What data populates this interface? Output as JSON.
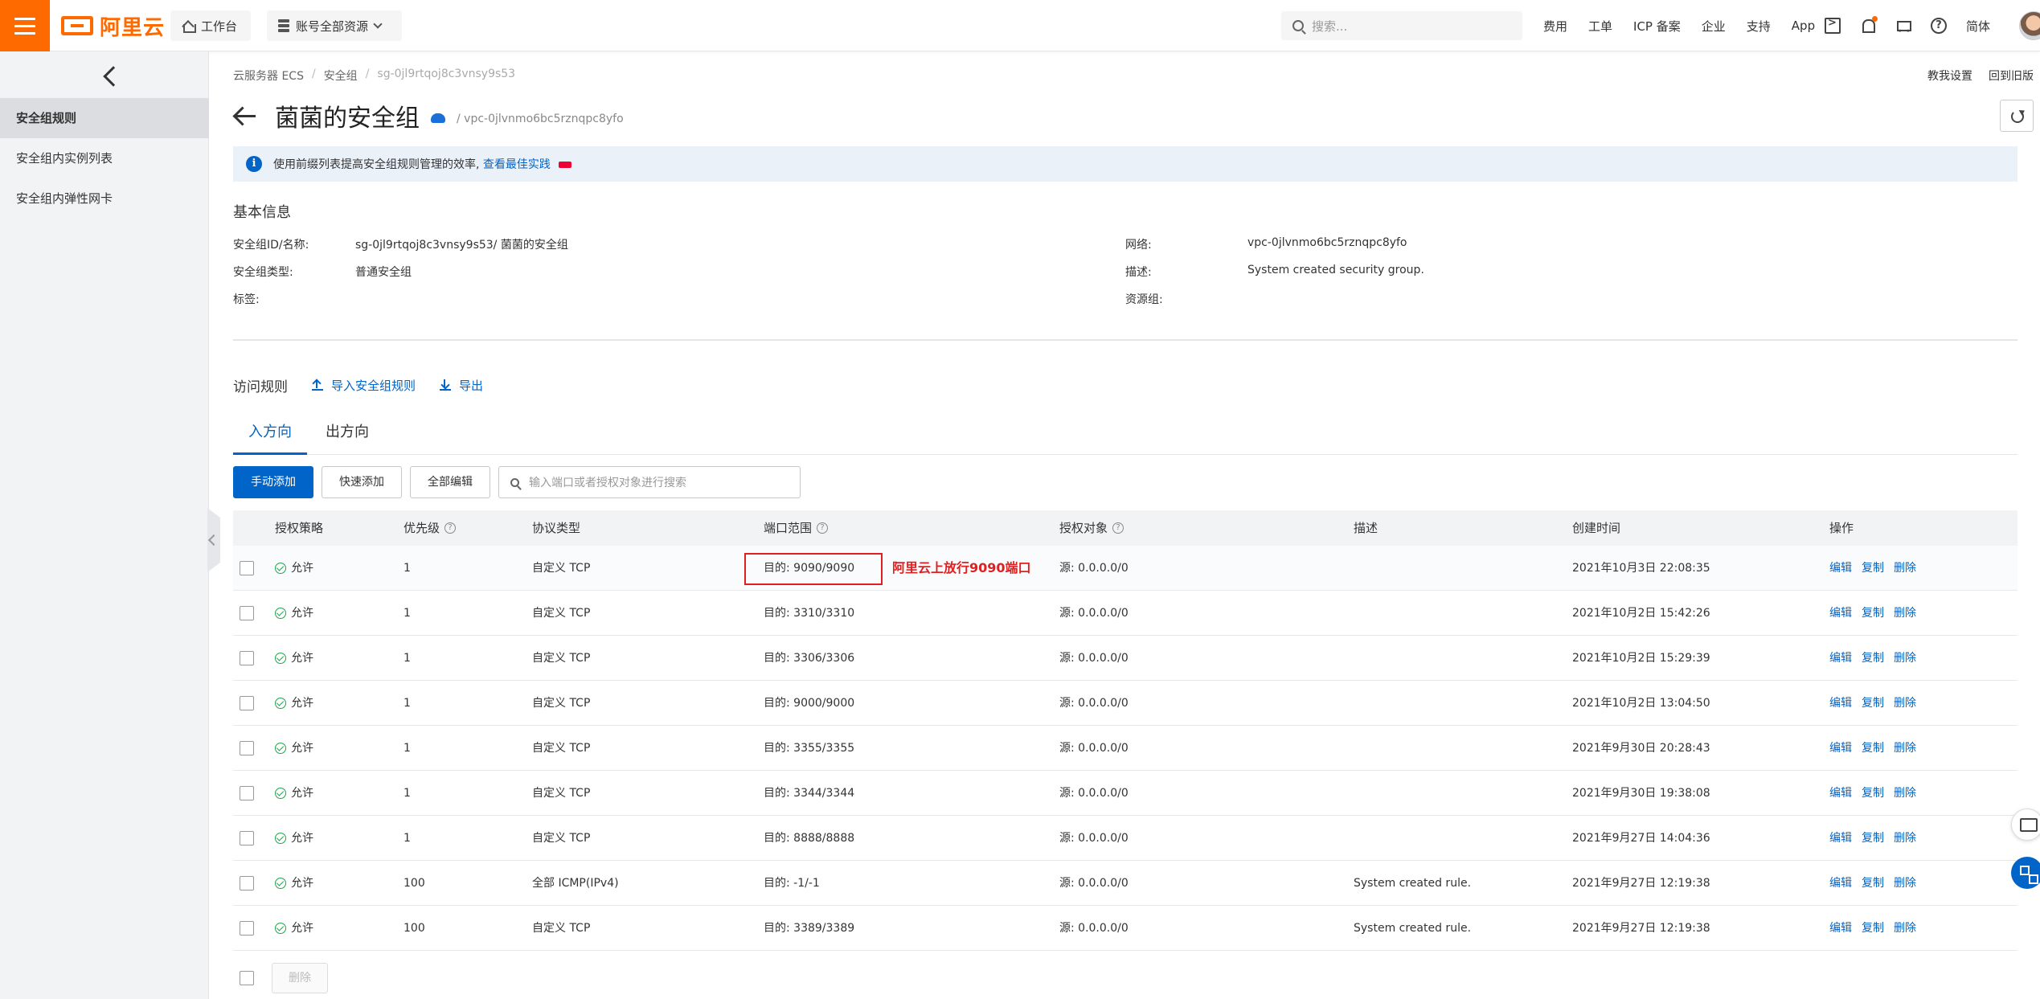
{
  "topbar": {
    "logo_text": "阿里云",
    "workbench": "工作台",
    "resources": "账号全部资源",
    "search_placeholder": "搜索...",
    "links": [
      "费用",
      "工单",
      "ICP 备案",
      "企业",
      "支持",
      "App"
    ],
    "lang": "简体",
    "brand_color": "#ff6a00"
  },
  "sidebar": {
    "items": [
      {
        "label": "安全组规则",
        "active": true
      },
      {
        "label": "安全组内实例列表",
        "active": false
      },
      {
        "label": "安全组内弹性网卡",
        "active": false
      }
    ]
  },
  "breadcrumb": {
    "items": [
      "云服务器 ECS",
      "安全组",
      "sg-0jl9rtqoj8c3vnsy9s53"
    ]
  },
  "header": {
    "title": "菌菌的安全组",
    "vpc": "/ vpc-0jlvnmo6bc5rznqpc8yfo",
    "links": [
      "教我设置",
      "回到旧版"
    ]
  },
  "notice": {
    "text": "使用前缀列表提高安全组规则管理的效率,",
    "link": "查看最佳实践"
  },
  "basic_info": {
    "title": "基本信息",
    "left": [
      {
        "k": "安全组ID/名称:",
        "v": "sg-0jl9rtqoj8c3vnsy9s53/ 菌菌的安全组"
      },
      {
        "k": "安全组类型:",
        "v": "普通安全组"
      },
      {
        "k": "标签:",
        "v": ""
      }
    ],
    "right": [
      {
        "k": "网络:",
        "v": "vpc-0jlvnmo6bc5rznqpc8yfo"
      },
      {
        "k": "描述:",
        "v": "System created security group."
      },
      {
        "k": "资源组:",
        "v": ""
      }
    ]
  },
  "rules": {
    "title": "访问规则",
    "import": "导入安全组规则",
    "export": "导出",
    "tabs": [
      "入方向",
      "出方向"
    ],
    "buttons": {
      "manual": "手动添加",
      "quick": "快速添加",
      "edit_all": "全部编辑"
    },
    "search_placeholder": "输入端口或者授权对象进行搜索",
    "columns": [
      "授权策略",
      "优先级",
      "协议类型",
      "端口范围",
      "授权对象",
      "描述",
      "创建时间",
      "操作"
    ],
    "annotation": "阿里云上放行9090端口",
    "ops": [
      "编辑",
      "复制",
      "删除"
    ],
    "delete_btn": "删除",
    "rows": [
      {
        "policy": "允许",
        "priority": "1",
        "protocol": "自定义 TCP",
        "port": "目的: 9090/9090",
        "auth": "源: 0.0.0.0/0",
        "desc": "",
        "time": "2021年10月3日 22:08:35"
      },
      {
        "policy": "允许",
        "priority": "1",
        "protocol": "自定义 TCP",
        "port": "目的: 3310/3310",
        "auth": "源: 0.0.0.0/0",
        "desc": "",
        "time": "2021年10月2日 15:42:26"
      },
      {
        "policy": "允许",
        "priority": "1",
        "protocol": "自定义 TCP",
        "port": "目的: 3306/3306",
        "auth": "源: 0.0.0.0/0",
        "desc": "",
        "time": "2021年10月2日 15:29:39"
      },
      {
        "policy": "允许",
        "priority": "1",
        "protocol": "自定义 TCP",
        "port": "目的: 9000/9000",
        "auth": "源: 0.0.0.0/0",
        "desc": "",
        "time": "2021年10月2日 13:04:50"
      },
      {
        "policy": "允许",
        "priority": "1",
        "protocol": "自定义 TCP",
        "port": "目的: 3355/3355",
        "auth": "源: 0.0.0.0/0",
        "desc": "",
        "time": "2021年9月30日 20:28:43"
      },
      {
        "policy": "允许",
        "priority": "1",
        "protocol": "自定义 TCP",
        "port": "目的: 3344/3344",
        "auth": "源: 0.0.0.0/0",
        "desc": "",
        "time": "2021年9月30日 19:38:08"
      },
      {
        "policy": "允许",
        "priority": "1",
        "protocol": "自定义 TCP",
        "port": "目的: 8888/8888",
        "auth": "源: 0.0.0.0/0",
        "desc": "",
        "time": "2021年9月27日 14:04:36"
      },
      {
        "policy": "允许",
        "priority": "100",
        "protocol": "全部 ICMP(IPv4)",
        "port": "目的: -1/-1",
        "auth": "源: 0.0.0.0/0",
        "desc": "System created rule.",
        "time": "2021年9月27日 12:19:38"
      },
      {
        "policy": "允许",
        "priority": "100",
        "protocol": "自定义 TCP",
        "port": "目的: 3389/3389",
        "auth": "源: 0.0.0.0/0",
        "desc": "System created rule.",
        "time": "2021年9月27日 12:19:38"
      }
    ]
  }
}
